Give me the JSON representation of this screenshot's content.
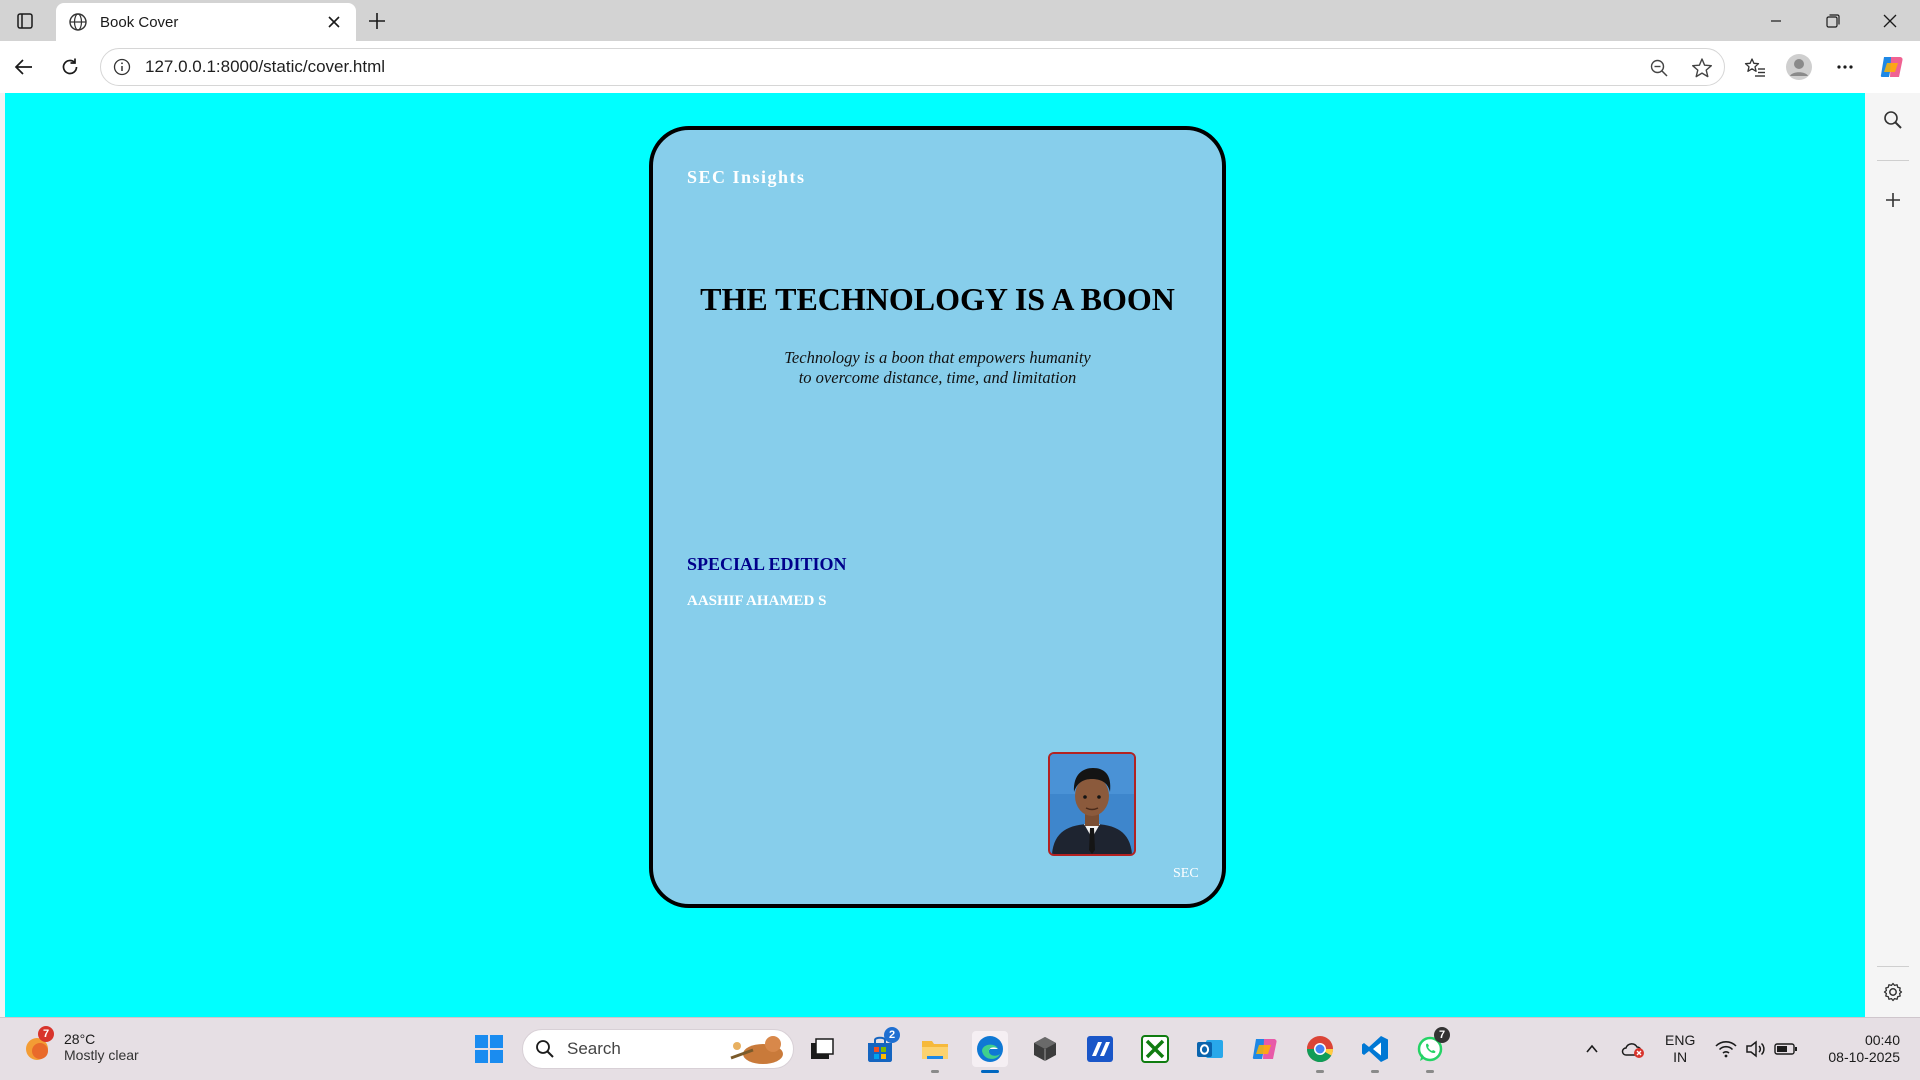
{
  "browser": {
    "tab_title": "Book Cover",
    "url": "127.0.0.1:8000/static/cover.html"
  },
  "cover": {
    "brand": "SEC Insights",
    "title": "THE TECHNOLOGY IS A BOON",
    "subtitle_line1": "Technology is a boon that empowers humanity",
    "subtitle_line2": "to overcome distance, time, and limitation",
    "edition": "SPECIAL EDITION",
    "author": "AASHIF AHAMED S",
    "footer": "SEC",
    "colors": {
      "page_background": "#00ffff",
      "cover_background": "#87ceeb",
      "edition_text": "#00008b"
    }
  },
  "sidebar": {
    "icons": [
      "search-icon",
      "add-icon",
      "settings-icon"
    ]
  },
  "taskbar": {
    "weather_temp": "28°C",
    "weather_desc": "Mostly clear",
    "weather_badge": "7",
    "search_label": "Search",
    "store_badge": "2",
    "whatsapp_badge": "7",
    "language": "ENG",
    "region": "IN",
    "time": "00:40",
    "date": "08-10-2025"
  }
}
